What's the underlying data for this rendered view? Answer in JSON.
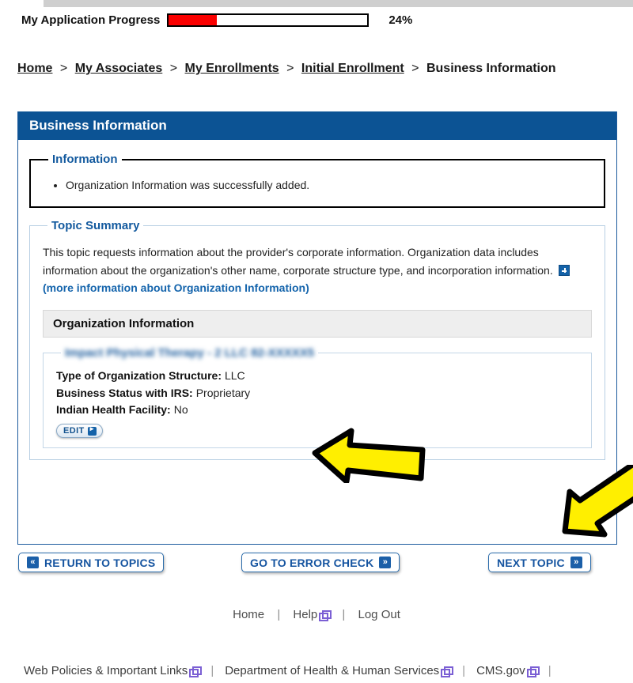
{
  "progress": {
    "label": "My Application Progress",
    "percent_text": "24%",
    "percent_value": 24,
    "fill_color": "#fb0000"
  },
  "breadcrumb": {
    "items": [
      {
        "label": "Home",
        "link": true
      },
      {
        "label": "My Associates",
        "link": true
      },
      {
        "label": "My Enrollments",
        "link": true
      },
      {
        "label": "Initial Enrollment",
        "link": true
      },
      {
        "label": "Business Information",
        "link": false
      }
    ],
    "separator": ">"
  },
  "panel": {
    "title": "Business Information",
    "header_color": "#0c5394",
    "information": {
      "legend": "Information",
      "messages": [
        "Organization Information was successfully added."
      ]
    },
    "topic_summary": {
      "legend": "Topic Summary",
      "text": "This topic requests information about the provider's corporate information. Organization data includes information about the organization's other name, corporate structure type, and incorporation information.",
      "more_info_link": "(more information about Organization Information)",
      "more_info_icon": "plus-square-icon"
    },
    "organization_information": {
      "section_title": "Organization Information",
      "record_legend_blurred": "Impact Physical Therapy - 2 LLC 82-XXXXX",
      "record_legend_visible_suffix": "5",
      "fields": [
        {
          "label": "Type of Organization Structure:",
          "value": "LLC"
        },
        {
          "label": "Business Status with IRS:",
          "value": "Proprietary"
        },
        {
          "label": "Indian Health Facility:",
          "value": "No"
        }
      ],
      "edit_button": "EDIT"
    }
  },
  "actions": {
    "return_to_topics": "RETURN TO TOPICS",
    "go_to_error_check": "GO TO ERROR CHECK",
    "next_topic": "NEXT TOPIC",
    "chevron_left": "«",
    "chevron_right": "»"
  },
  "footer": {
    "links": [
      {
        "label": "Home",
        "external": false
      },
      {
        "label": "Help",
        "external": true
      },
      {
        "label": "Log Out",
        "external": false
      }
    ],
    "divider": "|"
  },
  "bottom_bar": {
    "links": [
      {
        "label": "Web Policies & Important Links",
        "external": true
      },
      {
        "label": "Department of Health & Human Services",
        "external": true
      },
      {
        "label": "CMS.gov",
        "external": true
      }
    ],
    "divider": "|"
  },
  "annotations": {
    "arrows": [
      {
        "name": "arrow-pointing-to-organization-fields",
        "direction": "left"
      },
      {
        "name": "arrow-pointing-to-next-topic",
        "direction": "down-left"
      }
    ],
    "fill_color": "#ffef00",
    "outline_color": "#000000"
  }
}
